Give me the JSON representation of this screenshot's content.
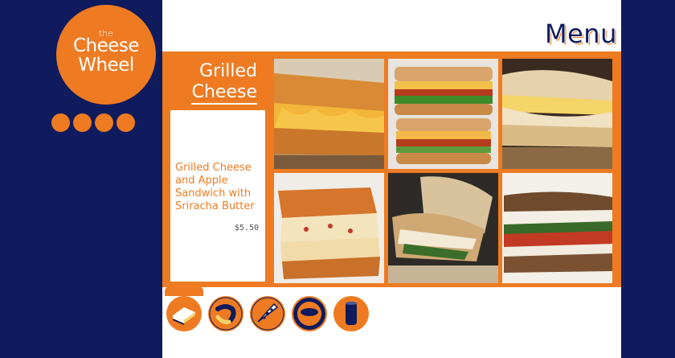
{
  "brand": {
    "logo_small": "the",
    "logo_line1": "Cheese",
    "logo_line2": "Wheel"
  },
  "header": {
    "title": "Menu"
  },
  "category": {
    "title_line1": "Grilled",
    "title_line2": "Cheese"
  },
  "selected_item": {
    "name": "Grilled Cheese and Apple Sandwich with Sriracha Butter",
    "price": "$5.50"
  },
  "gallery": {
    "items": [
      {
        "icon": "sandwich-photo",
        "colors": [
          "#e9a43a",
          "#c9772a",
          "#f3c24b"
        ]
      },
      {
        "icon": "sandwich-photo",
        "colors": [
          "#d77b2c",
          "#b33d1b",
          "#f2c14a"
        ]
      },
      {
        "icon": "sandwich-photo",
        "colors": [
          "#e0c493",
          "#8a6a45",
          "#f6d77c"
        ]
      },
      {
        "icon": "sandwich-photo",
        "colors": [
          "#d66a2a",
          "#f3e1b7",
          "#b23e2a"
        ]
      },
      {
        "icon": "sandwich-photo",
        "colors": [
          "#c9a574",
          "#3d6e2d",
          "#f1e6c6"
        ]
      },
      {
        "icon": "sandwich-photo",
        "colors": [
          "#7a5232",
          "#c23a24",
          "#f2ece0"
        ]
      }
    ]
  },
  "category_nav": {
    "items": [
      {
        "icon": "sandwich-icon",
        "active": true
      },
      {
        "icon": "macaroni-icon",
        "active": false
      },
      {
        "icon": "pizza-slice-icon",
        "active": false
      },
      {
        "icon": "soup-bowl-icon",
        "active": false
      },
      {
        "icon": "drink-can-icon",
        "active": false
      }
    ]
  },
  "colors": {
    "navy": "#0f1b5c",
    "orange": "#ee7b22",
    "white": "#ffffff"
  }
}
